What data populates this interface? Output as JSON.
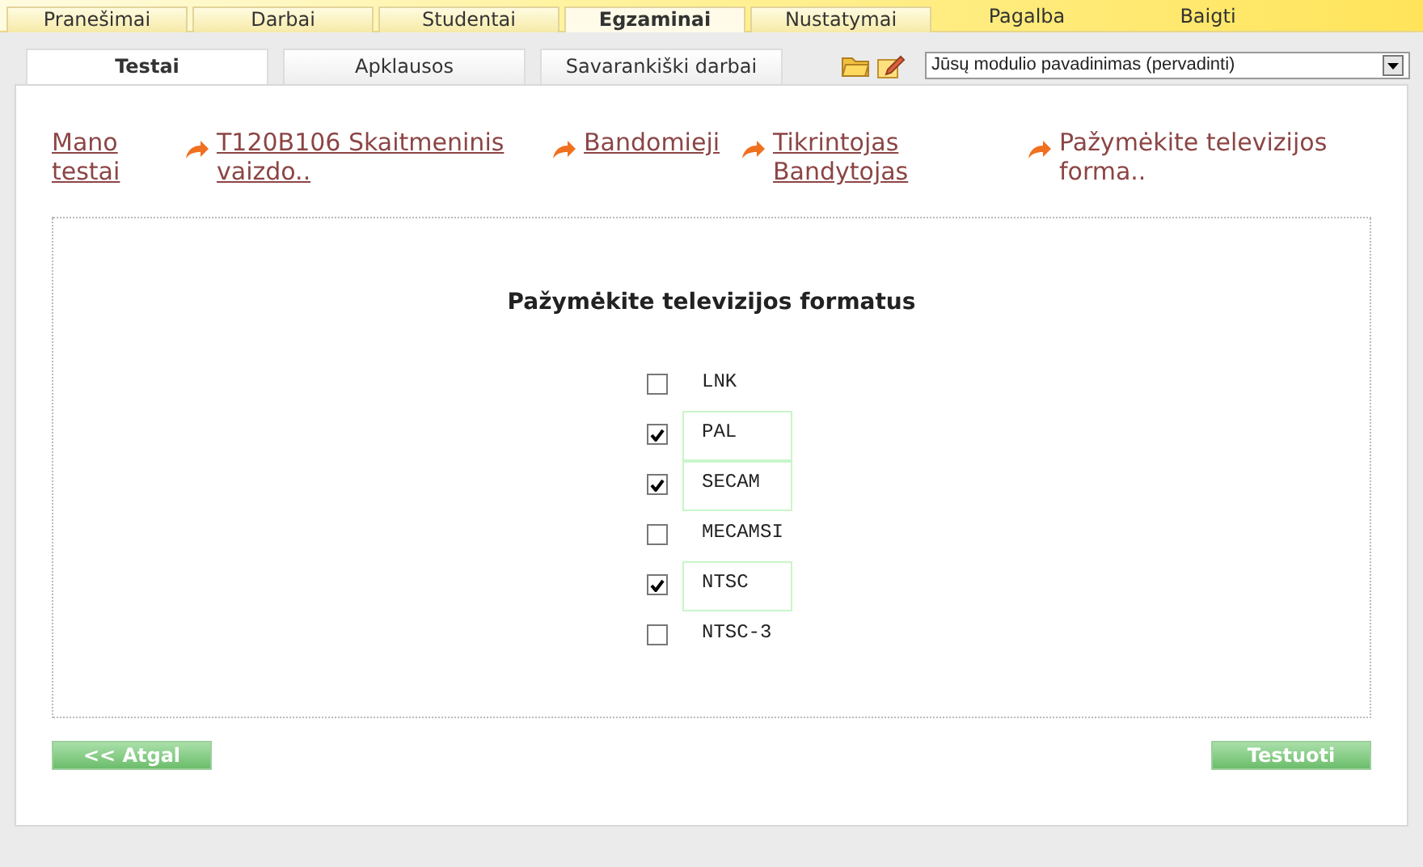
{
  "top_menu": [
    {
      "label": "Pranešimai",
      "kind": "tab",
      "selected": false
    },
    {
      "label": "Darbai",
      "kind": "tab",
      "selected": false
    },
    {
      "label": "Studentai",
      "kind": "tab",
      "selected": false
    },
    {
      "label": "Egzaminai",
      "kind": "tab",
      "selected": true
    },
    {
      "label": "Nustatymai",
      "kind": "tab",
      "selected": false
    },
    {
      "label": "Pagalba",
      "kind": "link",
      "selected": false
    },
    {
      "label": "Baigti",
      "kind": "link",
      "selected": false
    }
  ],
  "sub_tabs": [
    {
      "label": "Testai",
      "selected": true
    },
    {
      "label": "Apklausos",
      "selected": false
    },
    {
      "label": "Savarankiški darbai",
      "selected": false
    }
  ],
  "module_select": {
    "value": "Jūsų modulio pavadinimas (pervadinti)"
  },
  "breadcrumbs": [
    {
      "label": "Mano testai",
      "link": true
    },
    {
      "label": "T120B106 Skaitmeninis vaizdo..",
      "link": true
    },
    {
      "label": "Bandomieji",
      "link": true
    },
    {
      "label": "Tikrintojas Bandytojas",
      "link": true
    },
    {
      "label": "Pažymėkite televizijos forma..",
      "link": false
    }
  ],
  "question": {
    "title": "Pažymėkite televizijos formatus",
    "options": [
      {
        "label": "LNK",
        "checked": false
      },
      {
        "label": "PAL",
        "checked": true
      },
      {
        "label": "SECAM",
        "checked": true
      },
      {
        "label": "MECAMSI",
        "checked": false
      },
      {
        "label": "NTSC",
        "checked": true
      },
      {
        "label": "NTSC-3",
        "checked": false
      }
    ]
  },
  "buttons": {
    "back": "<< Atgal",
    "test": "Testuoti"
  }
}
